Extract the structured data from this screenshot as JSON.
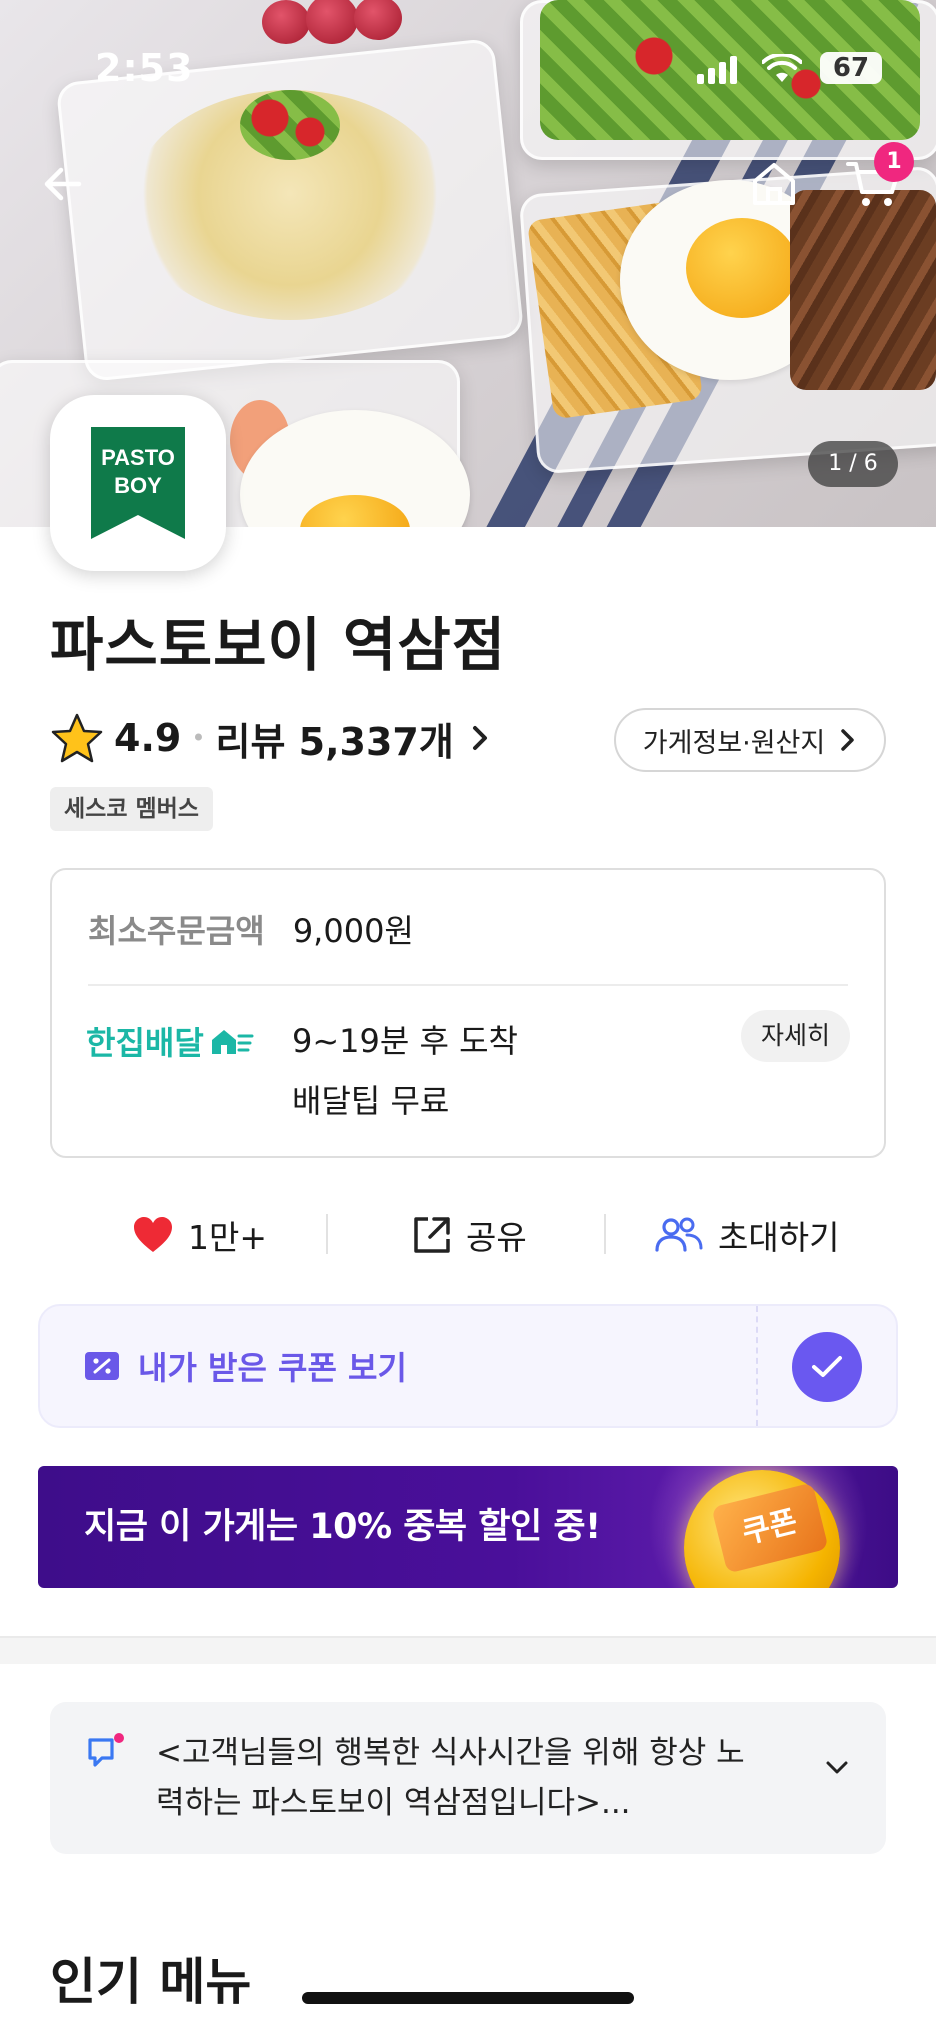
{
  "status_bar": {
    "time": "2:53",
    "battery": "67"
  },
  "hero": {
    "photo_counter": "1 / 6",
    "cart_count": "1"
  },
  "logo": {
    "line1": "PASTO",
    "line2": "BOY"
  },
  "store": {
    "name": "파스토보이 역삼점",
    "rating": "4.9",
    "reviews": "리뷰 5,337개",
    "info_button": "가게정보·원산지",
    "member_badge": "세스코 멤버스"
  },
  "delivery": {
    "min_order_label": "최소주문금액",
    "min_order_value": "9,000원",
    "type_label": "한집배달",
    "eta": "9~19분 후 도착",
    "tip": "배달팁 무료",
    "detail_button": "자세히"
  },
  "actions": {
    "like": "1만+",
    "share": "공유",
    "invite": "초대하기"
  },
  "coupon": {
    "label": "내가 받은 쿠폰 보기"
  },
  "promo": {
    "text": "지금 이 가게는 10% 중복 할인 중!",
    "badge": "쿠폰"
  },
  "notice": {
    "text": "<고객님들의 행복한 식사시간을 위해 항상 노력하는 파스토보이 역삼점입니다>..."
  },
  "section": {
    "title": "인기 메뉴"
  },
  "colors": {
    "accent_purple": "#6a58f0",
    "teal": "#1bb7a6",
    "badge_pink": "#f0277f",
    "logo_green": "#0f7a4a"
  }
}
